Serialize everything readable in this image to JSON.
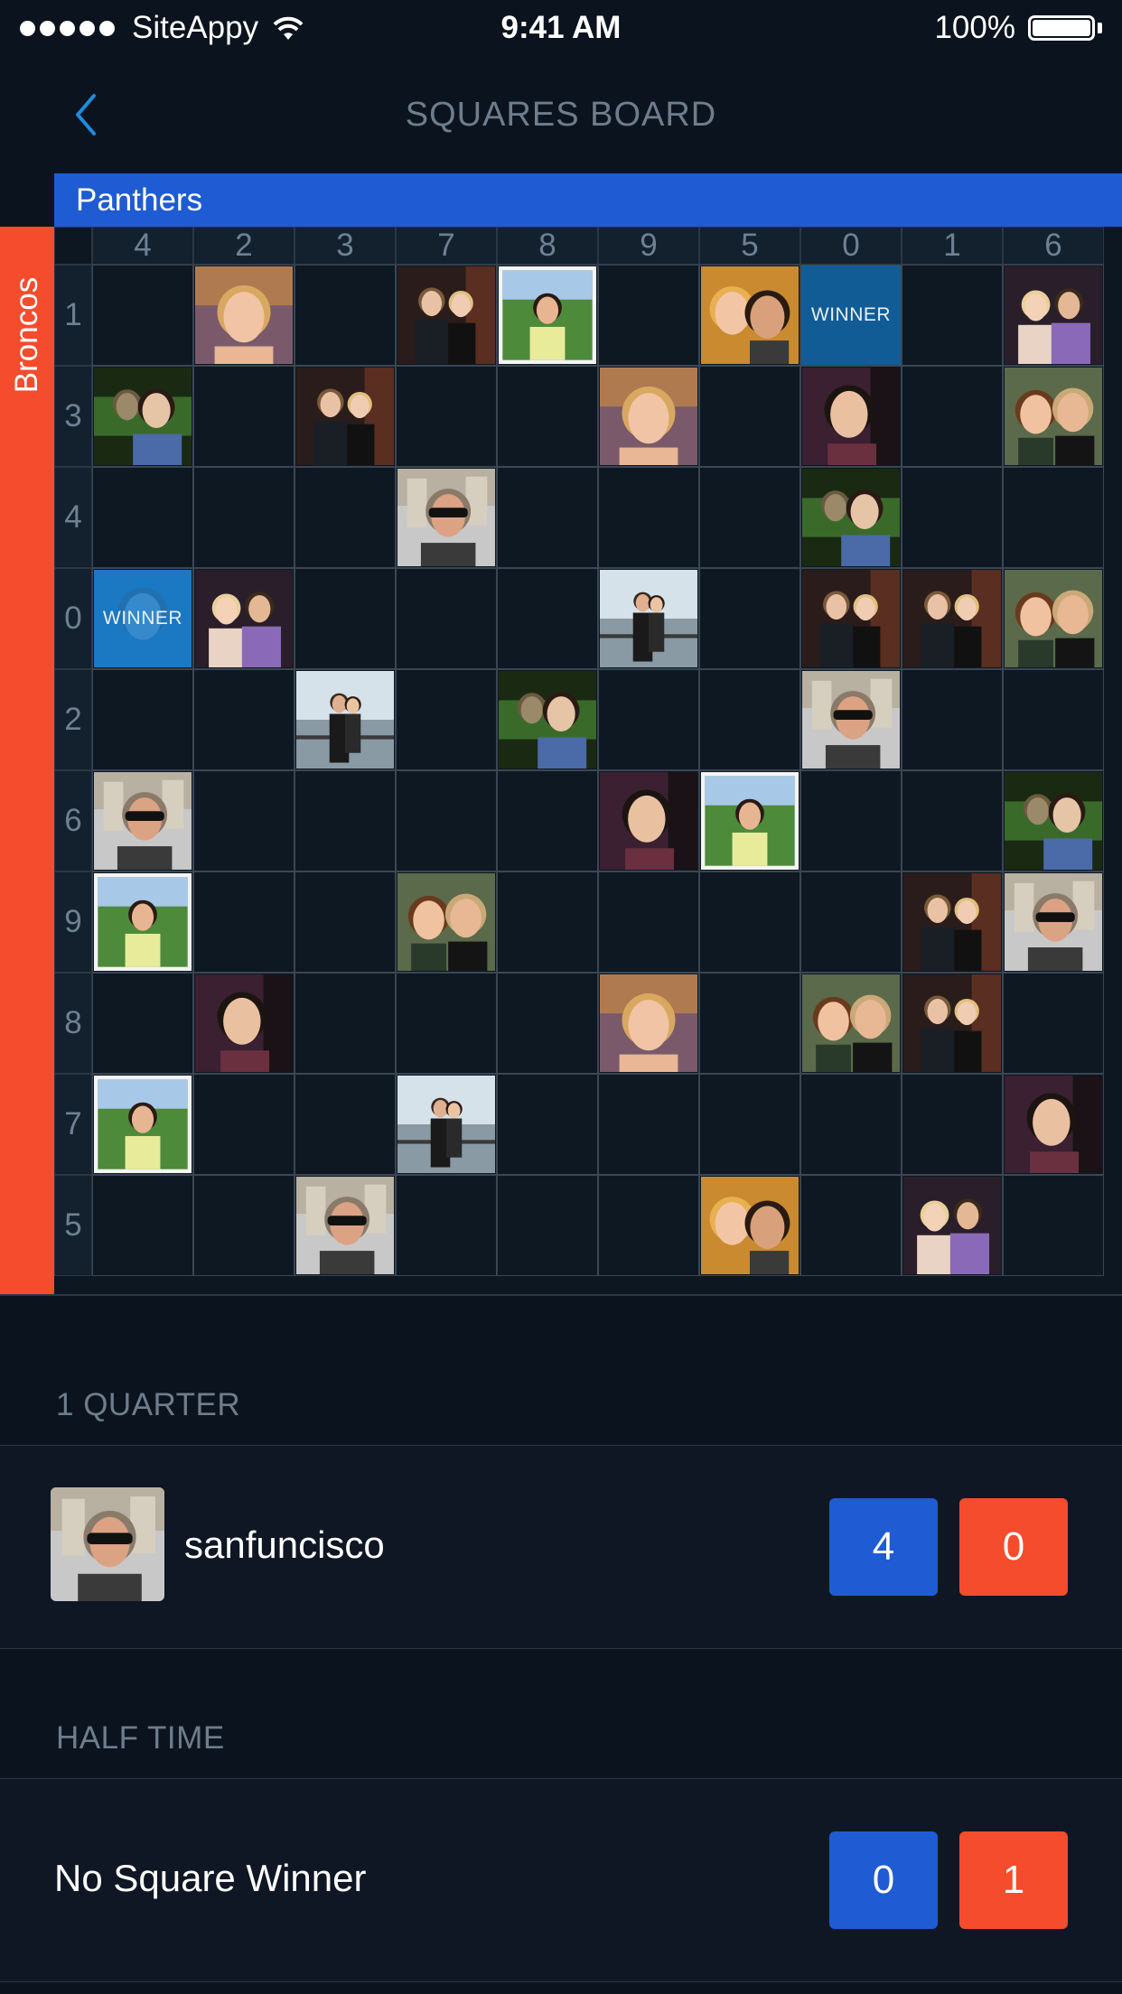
{
  "status_bar": {
    "carrier": "SiteAppy",
    "time": "9:41 AM",
    "battery": "100%"
  },
  "nav": {
    "title": "SQUARES BOARD",
    "back_icon": "chevron-left-icon"
  },
  "board": {
    "team_top": "Panthers",
    "team_left": "Broncos",
    "col_numbers": [
      "4",
      "2",
      "3",
      "7",
      "8",
      "9",
      "5",
      "0",
      "1",
      "6"
    ],
    "row_numbers": [
      "1",
      "3",
      "4",
      "0",
      "2",
      "6",
      "9",
      "8",
      "7",
      "5"
    ],
    "winner_label": "WINNER",
    "cells": [
      [
        null,
        "blonde",
        null,
        "couple-dark",
        "girl-grass",
        "blank-dark",
        "couple-selfie",
        "winner",
        null,
        "couple-purple"
      ],
      [
        "monkey",
        null,
        "couple-dark",
        null,
        null,
        "blonde",
        null,
        "man-scarf",
        null,
        "woman-man"
      ],
      [
        null,
        null,
        null,
        "sunglasses",
        null,
        null,
        null,
        "monkey",
        null,
        null
      ],
      [
        "winner-photo",
        "couple-purple",
        null,
        null,
        null,
        "couple-coast",
        null,
        "couple-dark",
        "couple-dark",
        "woman-man"
      ],
      [
        null,
        null,
        "couple-coast",
        null,
        "monkey",
        null,
        null,
        "sunglasses",
        null,
        null
      ],
      [
        "sunglasses",
        null,
        null,
        null,
        null,
        "man-scarf",
        "girl-grass",
        null,
        null,
        "monkey"
      ],
      [
        "girl-grass",
        null,
        null,
        "woman-man",
        null,
        null,
        null,
        null,
        "couple-dark",
        "sunglasses"
      ],
      [
        null,
        "man-scarf",
        null,
        null,
        null,
        "blonde",
        null,
        "woman-man",
        "couple-dark",
        null
      ],
      [
        "girl-grass",
        null,
        null,
        "couple-coast",
        null,
        null,
        null,
        null,
        null,
        "man-scarf"
      ],
      [
        null,
        null,
        "sunglasses",
        null,
        null,
        null,
        "couple-selfie",
        null,
        "couple-purple",
        null
      ]
    ]
  },
  "quarters": [
    {
      "title": "1 QUARTER",
      "winner_name": "sanfuncisco",
      "avatar": "sunglasses",
      "score_top": "4",
      "score_left": "0"
    },
    {
      "title": "HALF TIME",
      "winner_name": "No Square Winner",
      "score_top": "0",
      "score_left": "1"
    }
  ],
  "colors": {
    "panthers_blue": "#1f5bd3",
    "broncos_orange": "#f44c2c",
    "background": "#0b131e",
    "winner_blue": "#125c96"
  }
}
